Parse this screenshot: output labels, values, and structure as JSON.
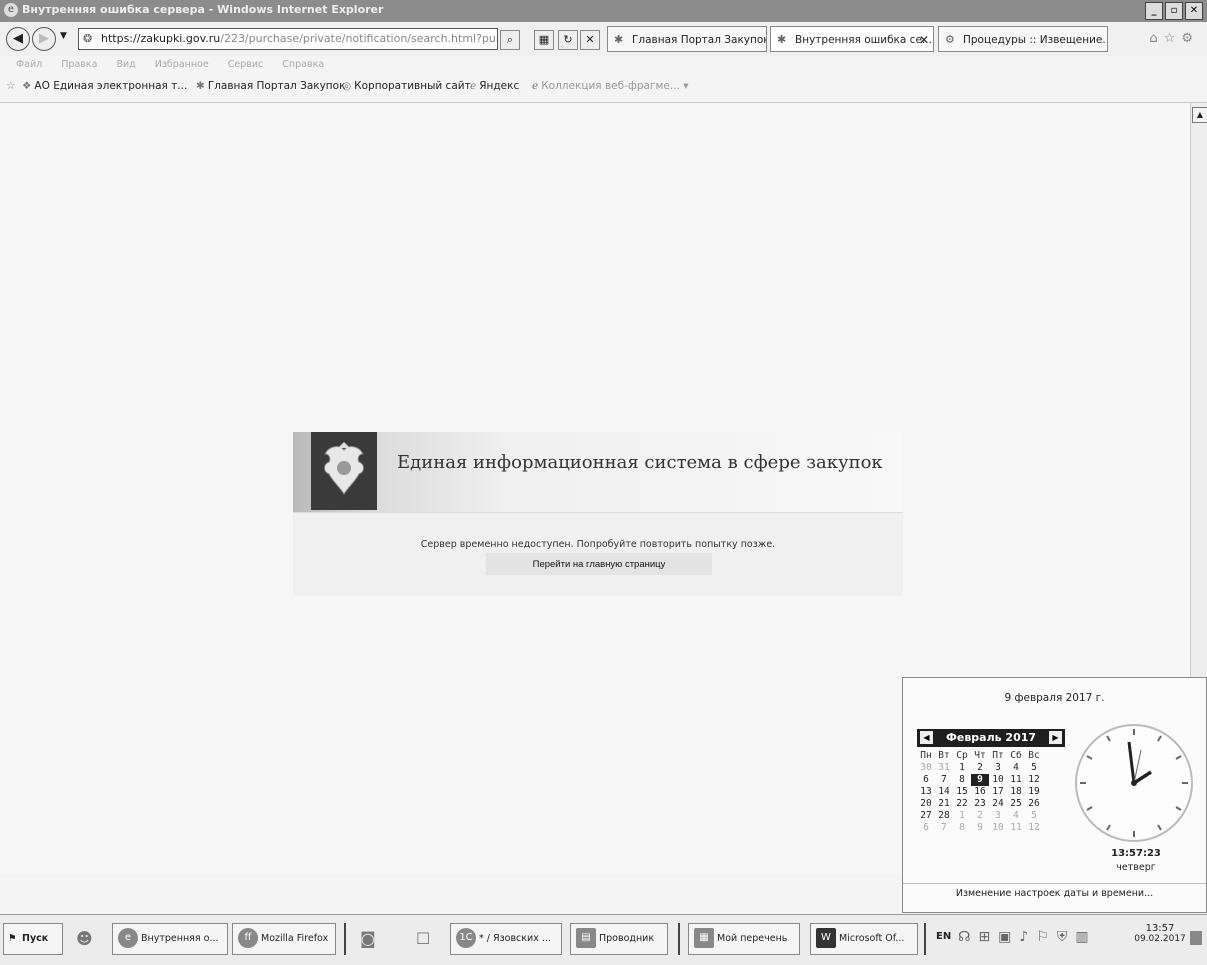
{
  "window": {
    "title": "Внутренняя ошибка сервера - Windows Internet Explorer"
  },
  "address": {
    "prefix": "https://",
    "host": "zakupki.gov.ru",
    "path": "/223/purchase/private/notification/search.html?purchaseSt"
  },
  "tabs": [
    {
      "label": "Главная Портал Закупок"
    },
    {
      "label": "Внутренняя ошибка се..."
    },
    {
      "label": "Процедуры :: Извещение..."
    }
  ],
  "menu": [
    "Файл",
    "Правка",
    "Вид",
    "Избранное",
    "Сервис",
    "Справка"
  ],
  "favorites": [
    {
      "label": "АО Единая электронная т..."
    },
    {
      "label": "Главная Портал Закупок"
    },
    {
      "label": "Корпоративный сайт"
    },
    {
      "label": "Яндекс"
    },
    {
      "label": "Коллекция веб-фрагме..."
    }
  ],
  "page": {
    "banner_title": "Единая информационная система в сфере закупок",
    "error_message": "Сервер временно недоступен. Попробуйте повторить попытку позже.",
    "home_link": "Перейти на главную страницу"
  },
  "calendar": {
    "full_date": "9 февраля 2017 г.",
    "month_label": "Февраль 2017",
    "weekdays": [
      "Пн",
      "Вт",
      "Ср",
      "Чт",
      "Пт",
      "Сб",
      "Вс"
    ],
    "weeks": [
      [
        "30",
        "31",
        "1",
        "2",
        "3",
        "4",
        "5"
      ],
      [
        "6",
        "7",
        "8",
        "9",
        "10",
        "11",
        "12"
      ],
      [
        "13",
        "14",
        "15",
        "16",
        "17",
        "18",
        "19"
      ],
      [
        "20",
        "21",
        "22",
        "23",
        "24",
        "25",
        "26"
      ],
      [
        "27",
        "28",
        "1",
        "2",
        "3",
        "4",
        "5"
      ],
      [
        "6",
        "7",
        "8",
        "9",
        "10",
        "11",
        "12"
      ]
    ],
    "time": "13:57:23",
    "weekday": "четверг",
    "settings_link": "Изменение настроек даты и времени..."
  },
  "taskbar": {
    "start": "Пуск",
    "buttons": [
      {
        "label": "Внутренняя о..."
      },
      {
        "label": "Mozilla Firefox"
      },
      {
        "label": "* / Язовских ..."
      },
      {
        "label": "Проводник"
      },
      {
        "label": "Мой перечень"
      },
      {
        "label": "Microsoft Of..."
      }
    ],
    "lang": "EN",
    "clock_time": "13:57",
    "clock_date": "09.02.2017"
  }
}
